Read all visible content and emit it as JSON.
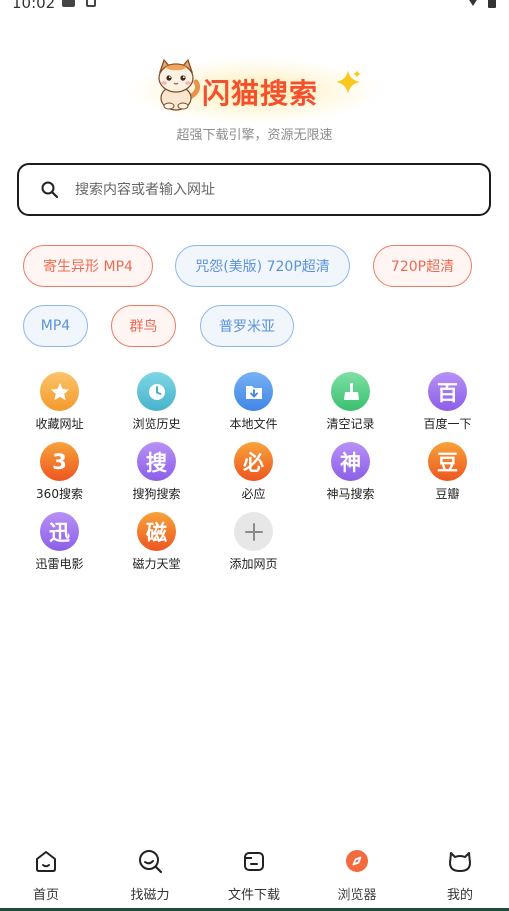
{
  "status_bar": {
    "time": "10:02"
  },
  "brand": {
    "name": "闪猫搜索",
    "slogan": "超强下载引擎，资源无限速",
    "color": "#f4502d"
  },
  "search": {
    "placeholder": "搜索内容或者输入网址"
  },
  "hot_tags": [
    {
      "label": "寄生异形 MP4",
      "style": "red"
    },
    {
      "label": "咒怨(美版) 720P超清",
      "style": "blue"
    },
    {
      "label": "720P超清",
      "style": "red"
    },
    {
      "label": "MP4",
      "style": "blue"
    },
    {
      "label": "群鸟",
      "style": "red"
    },
    {
      "label": "普罗米亚",
      "style": "blue"
    }
  ],
  "shortcuts": [
    {
      "label": "收藏网址",
      "icon": "star-icon"
    },
    {
      "label": "浏览历史",
      "icon": "clock-icon"
    },
    {
      "label": "本地文件",
      "icon": "folder-download-icon"
    },
    {
      "label": "清空记录",
      "icon": "broom-icon"
    },
    {
      "label": "百度一下",
      "glyph": "百"
    },
    {
      "label": "360搜索",
      "glyph": "3"
    },
    {
      "label": "搜狗搜索",
      "glyph": "搜"
    },
    {
      "label": "必应",
      "glyph": "必"
    },
    {
      "label": "神马搜索",
      "glyph": "神"
    },
    {
      "label": "豆瓣",
      "glyph": "豆"
    },
    {
      "label": "迅雷电影",
      "glyph": "迅"
    },
    {
      "label": "磁力天堂",
      "glyph": "磁"
    },
    {
      "label": "添加网页",
      "icon": "plus-icon"
    }
  ],
  "bottom_nav": [
    {
      "label": "首页",
      "icon": "home-icon"
    },
    {
      "label": "找磁力",
      "icon": "magnet-search-icon"
    },
    {
      "label": "文件下载",
      "icon": "file-download-icon"
    },
    {
      "label": "浏览器",
      "icon": "compass-icon",
      "active": true
    },
    {
      "label": "我的",
      "icon": "cat-profile-icon"
    }
  ],
  "colors": {
    "orange": "#f7a236",
    "teal": "#5dc3d6",
    "blue": "#4b93ea",
    "green": "#4fcc7f",
    "purple": "#9b6ef0",
    "red_orange": "#f0622a",
    "nav_active": "#f26a3d"
  }
}
